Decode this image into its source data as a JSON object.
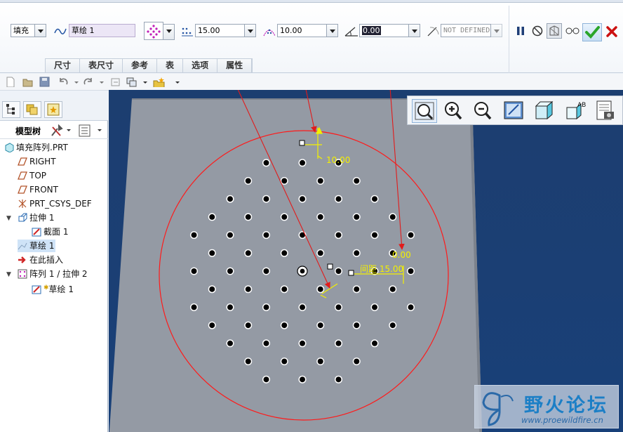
{
  "dashboard": {
    "fill_type": "填充",
    "sketch_label": "草绘 1",
    "spacing_value": "15.00",
    "border_value": "10.00",
    "rotation_value": "0.00",
    "radius_value": "NOT DEFINED",
    "tabs": [
      "尺寸",
      "表尺寸",
      "参考",
      "表",
      "选项",
      "属性"
    ]
  },
  "tree": {
    "header_label": "模型树",
    "items": [
      {
        "label": "填充阵列.PRT"
      },
      {
        "label": "RIGHT"
      },
      {
        "label": "TOP"
      },
      {
        "label": "FRONT"
      },
      {
        "label": "PRT_CSYS_DEF"
      },
      {
        "label": "拉伸 1"
      },
      {
        "label": "截面 1"
      },
      {
        "label": "草绘 1"
      },
      {
        "label": "在此插入"
      },
      {
        "label": "阵列 1 / 拉伸 2"
      },
      {
        "label": "草绘 1"
      }
    ]
  },
  "canvas_labels": {
    "border_dim": "10.00",
    "rotation_dim": "0.00",
    "spacing_dim": "间距 15.00"
  },
  "watermark": {
    "title": "野火论坛",
    "url": "www.proewildfire.cn"
  },
  "colors": {
    "accent_confirm": "#2aa52a",
    "cancel": "#cc1111",
    "sketch_red": "#ff1a1a",
    "dim_yellow": "#f3f000"
  }
}
